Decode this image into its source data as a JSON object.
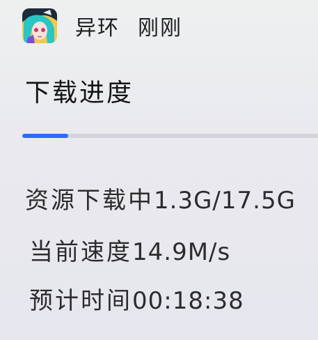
{
  "notification": {
    "app_name": "异环",
    "time": "刚刚",
    "app_icon": "anime-character-app-icon"
  },
  "title": "下载进度",
  "progress": {
    "fraction": 0.155,
    "accent_color": "#2f6bff"
  },
  "info": {
    "downloading_label": "资源下载中",
    "downloading_value": "1.3G/17.5G",
    "speed_label": "当前速度",
    "speed_value": "14.9M/s",
    "eta_label": "预计时间",
    "eta_value": "00:18:38"
  }
}
